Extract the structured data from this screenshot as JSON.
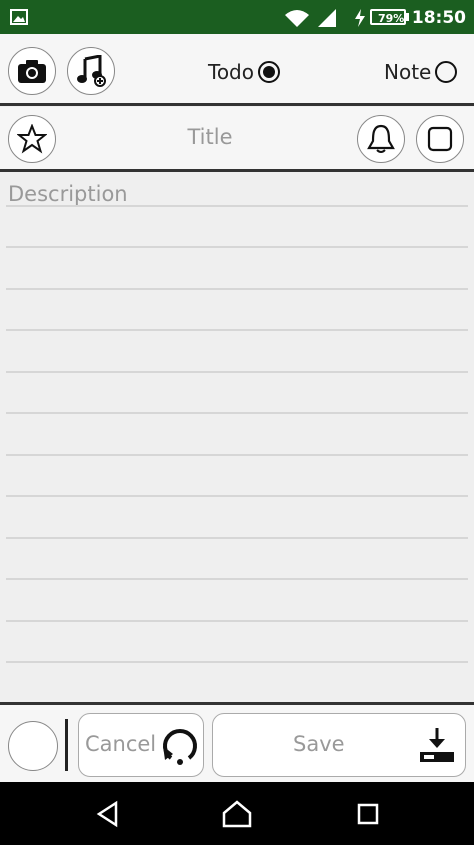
{
  "status_bar": {
    "time": "18:50",
    "battery_percent": "79%",
    "color": "#1b5e20"
  },
  "toolbar": {
    "camera_icon": "camera-icon",
    "music_icon": "music-note-icon",
    "todo_label": "Todo",
    "note_label": "Note",
    "selected_type": "Todo"
  },
  "title_bar": {
    "title_placeholder": "Title",
    "star_icon": "star-icon",
    "bell_icon": "bell-icon",
    "checkbox_icon": "checkbox-icon"
  },
  "description": {
    "placeholder": "Description"
  },
  "actions": {
    "cancel_label": "Cancel",
    "save_label": "Save"
  },
  "navbar": {
    "back_icon": "back-icon",
    "home_icon": "home-icon",
    "recents_icon": "recents-icon"
  }
}
